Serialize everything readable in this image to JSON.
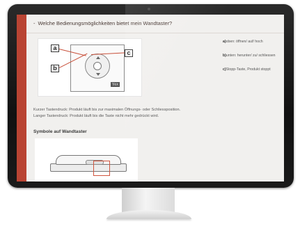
{
  "question": {
    "dash": "-",
    "text": "Welche Bedienungsmöglichkeiten bietet mein Wandtaster?"
  },
  "figure": {
    "callouts": [
      "a",
      "b",
      "c"
    ],
    "brand_label": "TRIX"
  },
  "legend": [
    {
      "key": "a)",
      "text": "oben: öffnen/ auf/ hoch"
    },
    {
      "key": "b)",
      "text": "unten: herunter/ zu/ schliessen"
    },
    {
      "key": "c)",
      "text": "Stopp-Taste, Produkt stoppt"
    }
  ],
  "description": [
    "Kurzer Tastendruck: Produkt läuft bis zur maximalen Öffnungs- oder Schliessposition.",
    "Langer Tastendruck: Produkt läuft bis die Taste nicht mehr gedrückt wird."
  ],
  "symbols_title": "Symbole auf Wandtaster",
  "colors": {
    "brand_red": "#b94433",
    "panel_bg": "#f1f0ee",
    "bezel": "#111111"
  },
  "icons": [
    "wall-switch-illustration",
    "remote-device-illustration"
  ]
}
